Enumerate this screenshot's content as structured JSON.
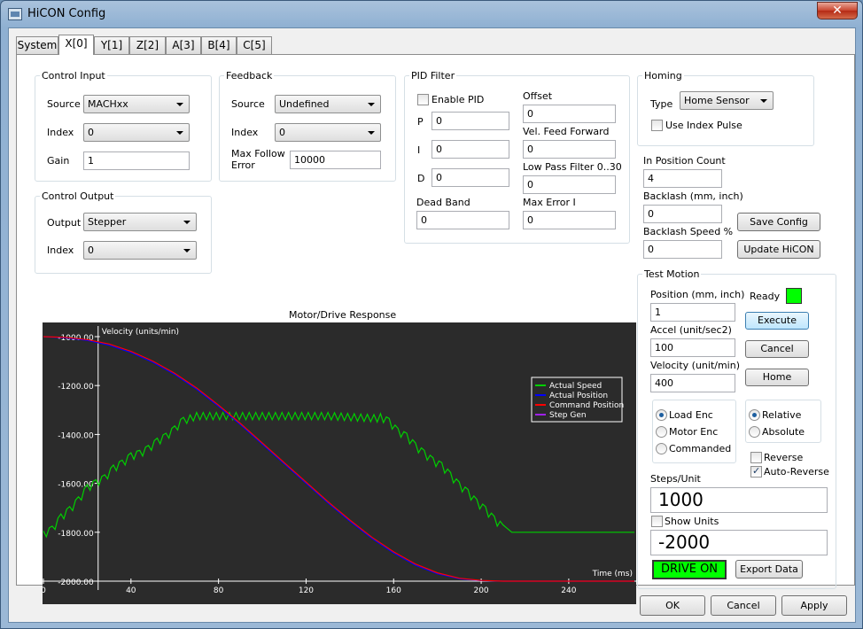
{
  "window": {
    "title": "HiCON Config",
    "close_label": "✕"
  },
  "tabs": [
    {
      "label": "System",
      "active": false
    },
    {
      "label": "X[0]",
      "active": true
    },
    {
      "label": "Y[1]",
      "active": false
    },
    {
      "label": "Z[2]",
      "active": false
    },
    {
      "label": "A[3]",
      "active": false
    },
    {
      "label": "B[4]",
      "active": false
    },
    {
      "label": "C[5]",
      "active": false
    }
  ],
  "control_input": {
    "title": "Control Input",
    "source_label": "Source",
    "source_value": "MACHxx",
    "index_label": "Index",
    "index_value": "0",
    "gain_label": "Gain",
    "gain_value": "1"
  },
  "control_output": {
    "title": "Control Output",
    "output_label": "Output",
    "output_value": "Stepper",
    "index_label": "Index",
    "index_value": "0"
  },
  "feedback": {
    "title": "Feedback",
    "source_label": "Source",
    "source_value": "Undefined",
    "index_label": "Index",
    "index_value": "0",
    "max_follow_label_1": "Max Follow",
    "max_follow_label_2": "Error",
    "max_follow_value": "10000"
  },
  "pid": {
    "title": "PID Filter",
    "enable_label": "Enable PID",
    "enabled": false,
    "p_label": "P",
    "p_value": "0",
    "i_label": "I",
    "i_value": "0",
    "d_label": "D",
    "d_value": "0",
    "dead_band_label": "Dead Band",
    "dead_band_value": "0",
    "offset_label": "Offset",
    "offset_value": "0",
    "vff_label": "Vel. Feed Forward",
    "vff_value": "0",
    "lpf_label": "Low Pass Filter 0..30",
    "lpf_value": "0",
    "max_error_label": "Max Error I",
    "max_error_value": "0"
  },
  "homing": {
    "title": "Homing",
    "type_label": "Type",
    "type_value": "Home Sensor",
    "index_pulse_label": "Use Index Pulse",
    "index_pulse": false
  },
  "right_settings": {
    "in_position_label": "In Position Count",
    "in_position_value": "4",
    "backlash_label": "Backlash (mm, inch)",
    "backlash_value": "0",
    "backlash_speed_label": "Backlash Speed %",
    "backlash_speed_value": "0",
    "save_config_label": "Save Config",
    "update_hicon_label": "Update HiCON"
  },
  "test_motion": {
    "title": "Test Motion",
    "position_label": "Position (mm, inch)",
    "position_value": "1",
    "accel_label": "Accel (unit/sec2)",
    "accel_value": "100",
    "velocity_label": "Velocity (unit/min)",
    "velocity_value": "400",
    "ready_label": "Ready",
    "execute_label": "Execute",
    "cancel_label": "Cancel",
    "home_label": "Home",
    "enc_options": [
      "Load Enc",
      "Motor Enc",
      "Commanded"
    ],
    "enc_selected": 0,
    "mode_options": [
      "Relative",
      "Absolute"
    ],
    "mode_selected": 0,
    "reverse_label": "Reverse",
    "reverse": false,
    "auto_reverse_label": "Auto-Reverse",
    "auto_reverse": true,
    "steps_unit_label": "Steps/Unit",
    "steps_unit_value": "1000",
    "show_units_label": "Show Units",
    "show_units": false,
    "position_readout": "-2000",
    "drive_on_label": "DRIVE ON",
    "export_label": "Export Data"
  },
  "footer": {
    "ok_label": "OK",
    "cancel_label": "Cancel",
    "apply_label": "Apply"
  },
  "colors": {
    "ready": "#00ff00",
    "drive_on": "#00ff00",
    "actual_speed": "#00d000",
    "actual_position": "#0000ff",
    "command_position": "#ff0000",
    "step_gen": "#a020f0",
    "chart_bg": "#2b2b2b"
  },
  "chart_data": {
    "type": "line",
    "title": "Motor/Drive Response",
    "ylabel": "Velocity (units/min)",
    "xlabel": "Time (ms)",
    "xlim": [
      0,
      270
    ],
    "ylim": [
      -2000,
      -1000
    ],
    "x_ticks": [
      0,
      40,
      80,
      120,
      160,
      200,
      240
    ],
    "y_ticks": [
      -1000,
      -1200,
      -1400,
      -1600,
      -1800,
      -2000
    ],
    "y_tick_labels": [
      "-1000.00",
      "-1200.00",
      "-1400.00",
      "-1600.00",
      "-1800.00",
      "-2000.00"
    ],
    "legend_position": "right",
    "series": [
      {
        "name": "Actual Speed",
        "x": [
          0,
          4,
          8,
          12,
          16,
          20,
          24,
          28,
          32,
          36,
          40,
          44,
          48,
          52,
          56,
          60,
          64,
          70,
          100,
          130,
          154,
          158,
          162,
          166,
          170,
          174,
          178,
          182,
          186,
          190,
          194,
          198,
          202,
          206,
          210,
          214,
          270
        ],
        "y": [
          -1800,
          -1780,
          -1730,
          -1700,
          -1660,
          -1610,
          -1590,
          -1570,
          -1530,
          -1510,
          -1480,
          -1470,
          -1450,
          -1420,
          -1400,
          -1370,
          -1330,
          -1310,
          -1310,
          -1310,
          -1320,
          -1340,
          -1380,
          -1400,
          -1440,
          -1470,
          -1500,
          -1520,
          -1560,
          -1600,
          -1630,
          -1670,
          -1700,
          -1740,
          -1770,
          -1800,
          -1800
        ]
      },
      {
        "name": "Actual Position",
        "x": [
          0,
          10,
          20,
          30,
          40,
          50,
          60,
          70,
          80,
          90,
          100,
          110,
          120,
          130,
          140,
          150,
          160,
          170,
          180,
          190,
          200,
          210,
          220,
          270
        ],
        "y": [
          -1000,
          -1005,
          -1015,
          -1035,
          -1065,
          -1105,
          -1155,
          -1215,
          -1285,
          -1360,
          -1440,
          -1520,
          -1600,
          -1680,
          -1755,
          -1825,
          -1885,
          -1935,
          -1970,
          -1990,
          -1998,
          -2000,
          -2000,
          -2000
        ]
      },
      {
        "name": "Command Position",
        "x": [
          0,
          10,
          20,
          30,
          40,
          50,
          60,
          70,
          80,
          90,
          100,
          110,
          120,
          130,
          140,
          150,
          160,
          170,
          180,
          190,
          200,
          210,
          220,
          270
        ],
        "y": [
          -1000,
          -1003,
          -1012,
          -1030,
          -1060,
          -1100,
          -1150,
          -1210,
          -1280,
          -1355,
          -1435,
          -1515,
          -1595,
          -1675,
          -1750,
          -1820,
          -1880,
          -1930,
          -1966,
          -1988,
          -1997,
          -2000,
          -2000,
          -2000
        ]
      },
      {
        "name": "Step Gen",
        "x": [],
        "y": []
      }
    ]
  }
}
